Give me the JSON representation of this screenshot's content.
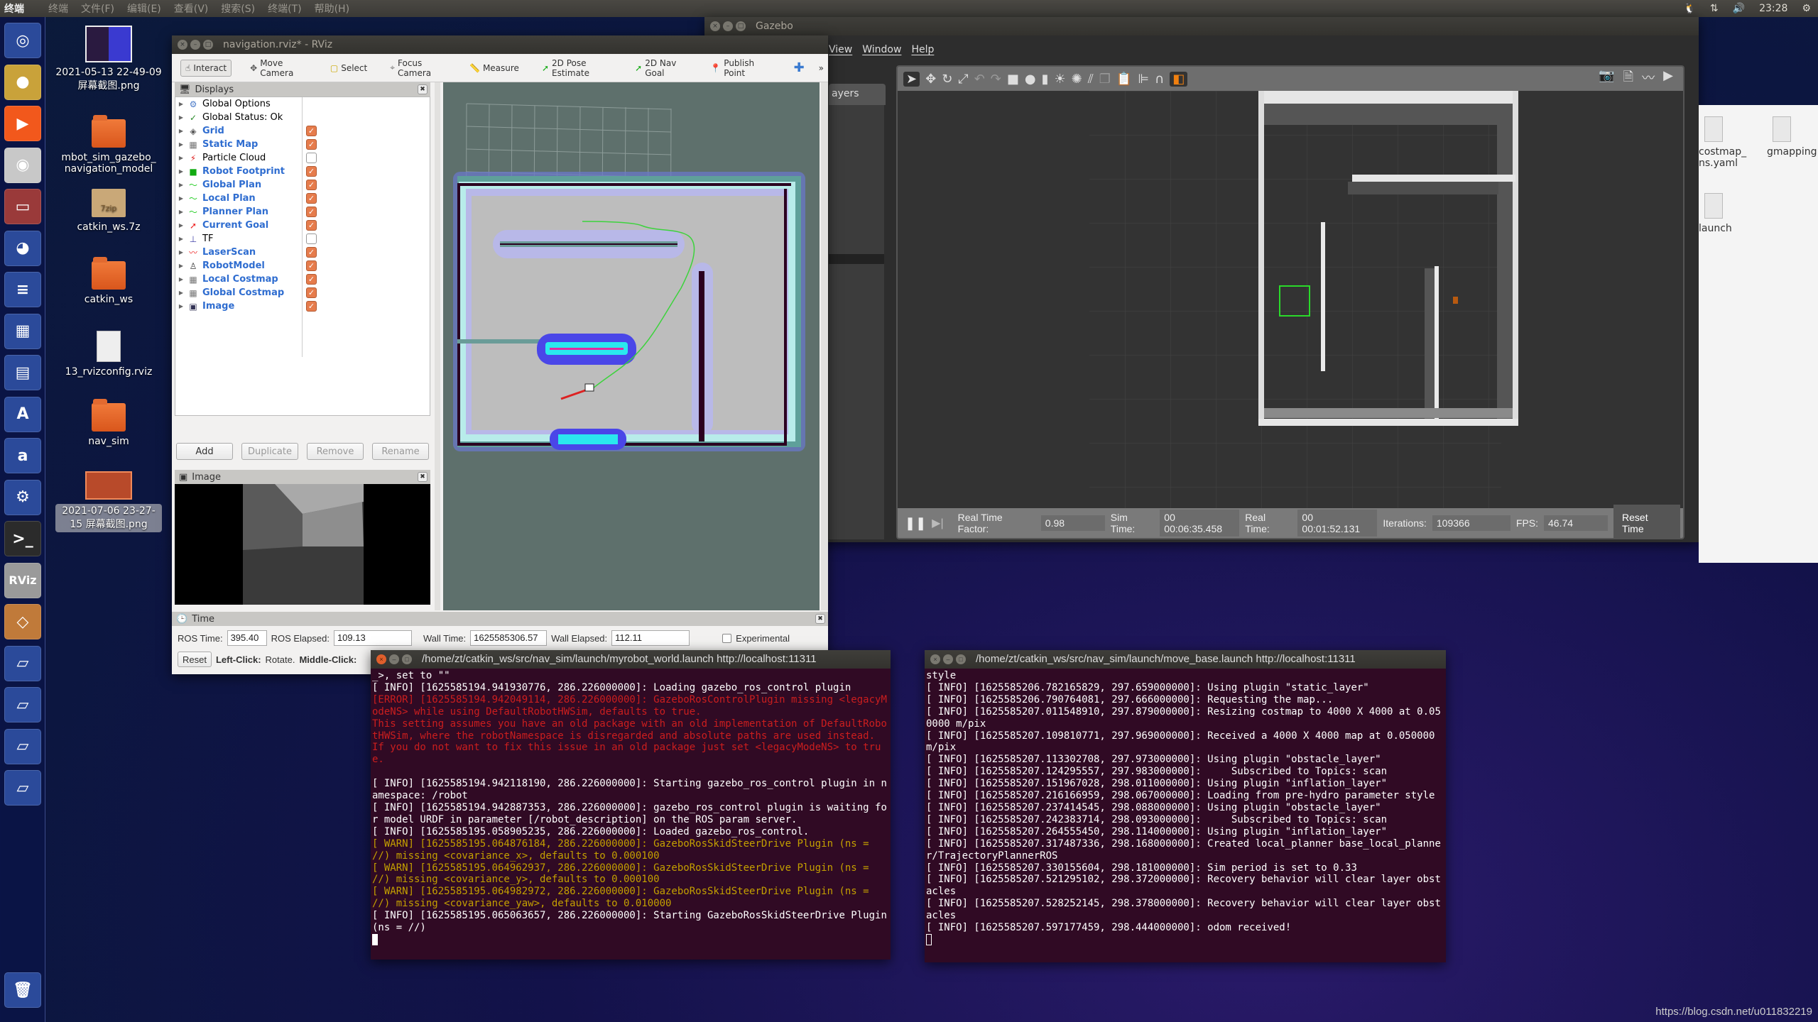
{
  "topbar": {
    "app_name": "终端",
    "menus": [
      "终端",
      "文件(F)",
      "编辑(E)",
      "查看(V)",
      "搜索(S)",
      "终端(T)",
      "帮助(H)"
    ],
    "clock": "23:28"
  },
  "launcher": [
    {
      "name": "ubuntu-dash",
      "glyph": "◎",
      "color": "#2b4a9a"
    },
    {
      "name": "chrome",
      "glyph": "●",
      "color": "#c9a23a"
    },
    {
      "name": "video-player",
      "glyph": "▶",
      "color": "#f2581c"
    },
    {
      "name": "camera",
      "glyph": "◉",
      "color": "#c8c8c8"
    },
    {
      "name": "file-cabinet",
      "glyph": "▭",
      "color": "#9a3a3a"
    },
    {
      "name": "firefox",
      "glyph": "◕",
      "color": "#2b4a9a"
    },
    {
      "name": "writer",
      "glyph": "≡",
      "color": "#2b4a9a"
    },
    {
      "name": "calc",
      "glyph": "▦",
      "color": "#2b4a9a"
    },
    {
      "name": "impress",
      "glyph": "▤",
      "color": "#2b4a9a"
    },
    {
      "name": "software-center",
      "glyph": "A",
      "color": "#2b4a9a"
    },
    {
      "name": "amazon",
      "glyph": "a",
      "color": "#2b4a9a"
    },
    {
      "name": "settings",
      "glyph": "⚙",
      "color": "#2b4a9a"
    },
    {
      "name": "terminal",
      "glyph": ">_",
      "color": "#2b2b2b"
    },
    {
      "name": "rviz",
      "glyph": "RViz",
      "color": "#9a9a9a"
    },
    {
      "name": "gazebo",
      "glyph": "◇",
      "color": "#c07a3a"
    },
    {
      "name": "drive-1",
      "glyph": "▱",
      "color": "#2b4a9a"
    },
    {
      "name": "drive-2",
      "glyph": "▱",
      "color": "#2b4a9a"
    },
    {
      "name": "drive-3",
      "glyph": "▱",
      "color": "#2b4a9a"
    },
    {
      "name": "drive-4",
      "glyph": "▱",
      "color": "#2b4a9a"
    },
    {
      "name": "trash",
      "glyph": "🗑",
      "color": "#2b4a9a"
    }
  ],
  "desktop": [
    {
      "label": "2021-05-13 22-49-09 屏幕截图.png",
      "type": "image"
    },
    {
      "label": "mbot_sim_gazebo_ navigation_model",
      "type": "folder"
    },
    {
      "label": "catkin_ws.7z",
      "type": "archive",
      "badge": "7zip"
    },
    {
      "label": "catkin_ws",
      "type": "folder"
    },
    {
      "label": "13_rvizconfig.rviz",
      "type": "file"
    },
    {
      "label": "nav_sim",
      "type": "folder"
    },
    {
      "label": "2021-07-06 23-27-15 屏幕截图.png",
      "type": "image-selected"
    }
  ],
  "rviz": {
    "title": "navigation.rviz* - RViz",
    "tools": [
      "Interact",
      "Move Camera",
      "Select",
      "Focus Camera",
      "Measure",
      "2D Pose Estimate",
      "2D Nav Goal",
      "Publish Point"
    ],
    "overflow": "»",
    "displays_title": "Displays",
    "displays": [
      {
        "label": "Global Options",
        "icon": "⚙",
        "icon_color": "#4a7ac8",
        "bold": false,
        "checkbox": null
      },
      {
        "label": "Global Status: Ok",
        "icon": "✓",
        "icon_color": "#2a8a2a",
        "bold": false,
        "checkbox": null
      },
      {
        "label": "Grid",
        "icon": "◈",
        "icon_color": "#555",
        "bold": true,
        "checkbox": true
      },
      {
        "label": "Static Map",
        "icon": "▦",
        "icon_color": "#777",
        "bold": true,
        "checkbox": true
      },
      {
        "label": "Particle Cloud",
        "icon": "⚡",
        "icon_color": "#d22",
        "bold": false,
        "checkbox": false
      },
      {
        "label": "Robot Footprint",
        "icon": "■",
        "icon_color": "#1a1",
        "bold": true,
        "checkbox": true
      },
      {
        "label": "Global Plan",
        "icon": "〜",
        "icon_color": "#2c2",
        "bold": true,
        "checkbox": true
      },
      {
        "label": "Local Plan",
        "icon": "〜",
        "icon_color": "#2c2",
        "bold": true,
        "checkbox": true
      },
      {
        "label": "Planner Plan",
        "icon": "〜",
        "icon_color": "#2c2",
        "bold": true,
        "checkbox": true
      },
      {
        "label": "Current Goal",
        "icon": "➚",
        "icon_color": "#e22",
        "bold": true,
        "checkbox": true
      },
      {
        "label": "TF",
        "icon": "⊥",
        "icon_color": "#44a",
        "bold": false,
        "checkbox": false
      },
      {
        "label": "LaserScan",
        "icon": "〰",
        "icon_color": "#e22",
        "bold": true,
        "checkbox": true
      },
      {
        "label": "RobotModel",
        "icon": "♙",
        "icon_color": "#333",
        "bold": true,
        "checkbox": true
      },
      {
        "label": "Local Costmap",
        "icon": "▦",
        "icon_color": "#777",
        "bold": true,
        "checkbox": true
      },
      {
        "label": "Global Costmap",
        "icon": "▦",
        "icon_color": "#777",
        "bold": true,
        "checkbox": true
      },
      {
        "label": "Image",
        "icon": "▣",
        "icon_color": "#335",
        "bold": true,
        "checkbox": true
      }
    ],
    "buttons": {
      "add": "Add",
      "duplicate": "Duplicate",
      "remove": "Remove",
      "rename": "Rename"
    },
    "image_panel_title": "Image",
    "time_panel": {
      "title": "Time",
      "ros_time_label": "ROS Time:",
      "ros_time": "395.40",
      "ros_elapsed_label": "ROS Elapsed:",
      "ros_elapsed": "109.13",
      "wall_time_label": "Wall Time:",
      "wall_time": "1625585306.57",
      "wall_elapsed_label": "Wall Elapsed:",
      "wall_elapsed": "112.11",
      "experimental_label": "Experimental",
      "experimental_checked": false
    },
    "status": {
      "reset": "Reset",
      "hint_bold1": "Left-Click:",
      "hint1": " Rotate.",
      "hint_bold2": " Middle-Click:"
    }
  },
  "gazebo": {
    "title": "Gazebo",
    "menus": [
      "View",
      "Window",
      "Help"
    ],
    "side_tab": "ayers",
    "bottom": {
      "rtf_label": "Real Time Factor:",
      "rtf": "0.98",
      "sim_label": "Sim Time:",
      "sim": "00 00:06:35.458",
      "real_label": "Real Time:",
      "real": "00 00:01:52.131",
      "iter_label": "Iterations:",
      "iter": "109366",
      "fps_label": "FPS:",
      "fps": "46.74",
      "reset": "Reset Time"
    }
  },
  "files": [
    {
      "label": "costmap_ ns.yaml"
    },
    {
      "label": "gmapping"
    },
    {
      "label": "launch"
    }
  ],
  "term1": {
    "title": "/home/zt/catkin_ws/src/nav_sim/launch/myrobot_world.launch http://localhost:11311",
    "lines": [
      {
        "t": "_>, set to \"\"",
        "c": ""
      },
      {
        "t": "[ INFO] [1625585194.941930776, 286.226000000]: Loading gazebo_ros_control plugin",
        "c": ""
      },
      {
        "t": "[ERROR] [1625585194.942049114, 286.226000000]: GazeboRosControlPlugin missing <legacyModeNS> while using DefaultRobotHWSim, defaults to true.",
        "c": "err"
      },
      {
        "t": "This setting assumes you have an old package with an old implementation of DefaultRobotHWSim, where the robotNamespace is disregarded and absolute paths are used instead.",
        "c": "err"
      },
      {
        "t": "If you do not want to fix this issue in an old package just set <legacyModeNS> to true.",
        "c": "err"
      },
      {
        "t": " ",
        "c": ""
      },
      {
        "t": "[ INFO] [1625585194.942118190, 286.226000000]: Starting gazebo_ros_control plugin in namespace: /robot",
        "c": ""
      },
      {
        "t": "[ INFO] [1625585194.942887353, 286.226000000]: gazebo_ros_control plugin is waiting for model URDF in parameter [/robot_description] on the ROS param server.",
        "c": ""
      },
      {
        "t": "[ INFO] [1625585195.058905235, 286.226000000]: Loaded gazebo_ros_control.",
        "c": ""
      },
      {
        "t": "[ WARN] [1625585195.064876184, 286.226000000]: GazeboRosSkidSteerDrive Plugin (ns = //) missing <covariance_x>, defaults to 0.000100",
        "c": "warn"
      },
      {
        "t": "[ WARN] [1625585195.064962937, 286.226000000]: GazeboRosSkidSteerDrive Plugin (ns = //) missing <covariance_y>, defaults to 0.000100",
        "c": "warn"
      },
      {
        "t": "[ WARN] [1625585195.064982972, 286.226000000]: GazeboRosSkidSteerDrive Plugin (ns = //) missing <covariance_yaw>, defaults to 0.010000",
        "c": "warn"
      },
      {
        "t": "[ INFO] [1625585195.065063657, 286.226000000]: Starting GazeboRosSkidSteerDrive Plugin (ns = //)",
        "c": ""
      }
    ]
  },
  "term2": {
    "title": "/home/zt/catkin_ws/src/nav_sim/launch/move_base.launch http://localhost:11311",
    "lines": [
      {
        "t": "style",
        "c": ""
      },
      {
        "t": "[ INFO] [1625585206.782165829, 297.659000000]: Using plugin \"static_layer\"",
        "c": ""
      },
      {
        "t": "[ INFO] [1625585206.790764081, 297.666000000]: Requesting the map...",
        "c": ""
      },
      {
        "t": "[ INFO] [1625585207.011548910, 297.879000000]: Resizing costmap to 4000 X 4000 at 0.050000 m/pix",
        "c": ""
      },
      {
        "t": "[ INFO] [1625585207.109810771, 297.969000000]: Received a 4000 X 4000 map at 0.050000 m/pix",
        "c": ""
      },
      {
        "t": "[ INFO] [1625585207.113302708, 297.973000000]: Using plugin \"obstacle_layer\"",
        "c": ""
      },
      {
        "t": "[ INFO] [1625585207.124295557, 297.983000000]:     Subscribed to Topics: scan",
        "c": ""
      },
      {
        "t": "[ INFO] [1625585207.151967028, 298.011000000]: Using plugin \"inflation_layer\"",
        "c": ""
      },
      {
        "t": "[ INFO] [1625585207.216166959, 298.067000000]: Loading from pre-hydro parameter style",
        "c": ""
      },
      {
        "t": "[ INFO] [1625585207.237414545, 298.088000000]: Using plugin \"obstacle_layer\"",
        "c": ""
      },
      {
        "t": "[ INFO] [1625585207.242383714, 298.093000000]:     Subscribed to Topics: scan",
        "c": ""
      },
      {
        "t": "[ INFO] [1625585207.264555450, 298.114000000]: Using plugin \"inflation_layer\"",
        "c": ""
      },
      {
        "t": "[ INFO] [1625585207.317487336, 298.168000000]: Created local_planner base_local_planner/TrajectoryPlannerROS",
        "c": ""
      },
      {
        "t": "[ INFO] [1625585207.330155604, 298.181000000]: Sim period is set to 0.33",
        "c": ""
      },
      {
        "t": "[ INFO] [1625585207.521295102, 298.372000000]: Recovery behavior will clear layer obstacles",
        "c": ""
      },
      {
        "t": "[ INFO] [1625585207.528252145, 298.378000000]: Recovery behavior will clear layer obstacles",
        "c": ""
      },
      {
        "t": "[ INFO] [1625585207.597177459, 298.444000000]: odom received!",
        "c": ""
      }
    ]
  },
  "watermark": "https://blog.csdn.net/u011832219"
}
